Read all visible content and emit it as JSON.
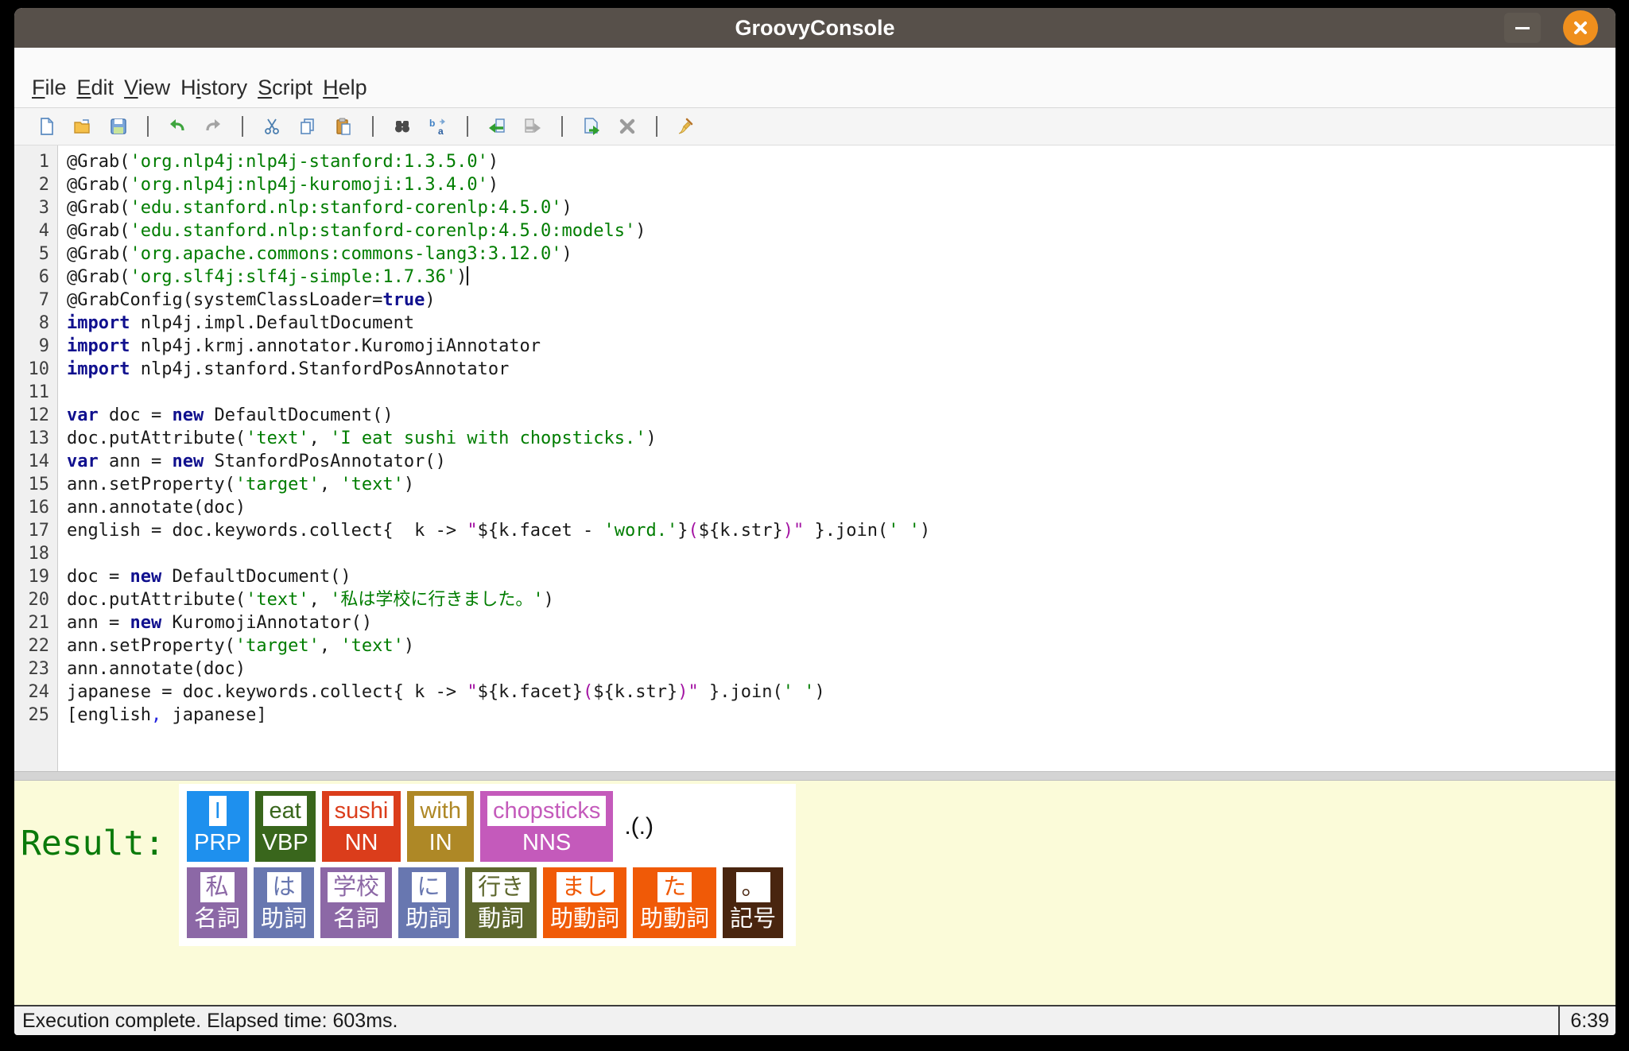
{
  "window": {
    "title": "GroovyConsole"
  },
  "menu": {
    "items": [
      {
        "label": "File",
        "underline": 0
      },
      {
        "label": "Edit",
        "underline": 0
      },
      {
        "label": "View",
        "underline": 0
      },
      {
        "label": "History",
        "underline": 1
      },
      {
        "label": "Script",
        "underline": 0
      },
      {
        "label": "Help",
        "underline": 0
      }
    ]
  },
  "toolbar": {
    "groups": [
      [
        "new-file",
        "open-file",
        "save-file"
      ],
      [
        "undo",
        "redo"
      ],
      [
        "cut",
        "copy",
        "paste"
      ],
      [
        "find",
        "find-replace"
      ],
      [
        "history-previous",
        "history-next"
      ],
      [
        "execute-script",
        "interrupt-script"
      ],
      [
        "clear-output"
      ]
    ]
  },
  "editor": {
    "lines": [
      {
        "no": "1",
        "segs": [
          [
            "p",
            "@Grab("
          ],
          [
            "s",
            "'org.nlp4j:nlp4j-stanford:1.3.5.0'"
          ],
          [
            "p",
            ")"
          ]
        ]
      },
      {
        "no": "2",
        "segs": [
          [
            "p",
            "@Grab("
          ],
          [
            "s",
            "'org.nlp4j:nlp4j-kuromoji:1.3.4.0'"
          ],
          [
            "p",
            ")"
          ]
        ]
      },
      {
        "no": "3",
        "segs": [
          [
            "p",
            "@Grab("
          ],
          [
            "s",
            "'edu.stanford.nlp:stanford-corenlp:4.5.0'"
          ],
          [
            "p",
            ")"
          ]
        ]
      },
      {
        "no": "4",
        "segs": [
          [
            "p",
            "@Grab("
          ],
          [
            "s",
            "'edu.stanford.nlp:stanford-corenlp:4.5.0:models'"
          ],
          [
            "p",
            ")"
          ]
        ]
      },
      {
        "no": "5",
        "segs": [
          [
            "p",
            "@Grab("
          ],
          [
            "s",
            "'org.apache.commons:commons-lang3:3.12.0'"
          ],
          [
            "p",
            ")"
          ]
        ]
      },
      {
        "no": "6",
        "segs": [
          [
            "p",
            "@Grab("
          ],
          [
            "s",
            "'org.slf4j:slf4j-simple:1.7.36'"
          ],
          [
            "p",
            ")"
          ]
        ],
        "caret": true
      },
      {
        "no": "7",
        "segs": [
          [
            "p",
            "@GrabConfig(systemClassLoader="
          ],
          [
            "k",
            "true"
          ],
          [
            "p",
            ")"
          ]
        ]
      },
      {
        "no": "8",
        "segs": [
          [
            "k",
            "import"
          ],
          [
            "p",
            " nlp4j.impl.DefaultDocument"
          ]
        ]
      },
      {
        "no": "9",
        "segs": [
          [
            "k",
            "import"
          ],
          [
            "p",
            " nlp4j.krmj.annotator.KuromojiAnnotator"
          ]
        ]
      },
      {
        "no": "10",
        "segs": [
          [
            "k",
            "import"
          ],
          [
            "p",
            " nlp4j.stanford.StanfordPosAnnotator"
          ]
        ]
      },
      {
        "no": "11",
        "segs": []
      },
      {
        "no": "12",
        "segs": [
          [
            "k",
            "var"
          ],
          [
            "p",
            " doc = "
          ],
          [
            "k",
            "new"
          ],
          [
            "p",
            " DefaultDocument()"
          ]
        ]
      },
      {
        "no": "13",
        "segs": [
          [
            "p",
            "doc.putAttribute("
          ],
          [
            "s",
            "'text'"
          ],
          [
            "p",
            ", "
          ],
          [
            "s",
            "'I eat sushi with chopsticks.'"
          ],
          [
            "p",
            ")"
          ]
        ]
      },
      {
        "no": "14",
        "segs": [
          [
            "k",
            "var"
          ],
          [
            "p",
            " ann = "
          ],
          [
            "k",
            "new"
          ],
          [
            "p",
            " StanfordPosAnnotator()"
          ]
        ]
      },
      {
        "no": "15",
        "segs": [
          [
            "p",
            "ann.setProperty("
          ],
          [
            "s",
            "'target'"
          ],
          [
            "p",
            ", "
          ],
          [
            "s",
            "'text'"
          ],
          [
            "p",
            ")"
          ]
        ]
      },
      {
        "no": "16",
        "segs": [
          [
            "p",
            "ann.annotate(doc)"
          ]
        ]
      },
      {
        "no": "17",
        "segs": [
          [
            "p",
            "english = doc.keywords.collect{  k -> "
          ],
          [
            "g",
            "\""
          ],
          [
            "p",
            "${k.facet - "
          ],
          [
            "s",
            "'word.'"
          ],
          [
            "p",
            "}"
          ],
          [
            "g",
            "("
          ],
          [
            "p",
            "${k.str}"
          ],
          [
            "g",
            ")\""
          ],
          [
            "p",
            " }.join("
          ],
          [
            "s",
            "' '"
          ],
          [
            "p",
            ")"
          ]
        ]
      },
      {
        "no": "18",
        "segs": []
      },
      {
        "no": "19",
        "segs": [
          [
            "p",
            "doc = "
          ],
          [
            "k",
            "new"
          ],
          [
            "p",
            " DefaultDocument()"
          ]
        ]
      },
      {
        "no": "20",
        "segs": [
          [
            "p",
            "doc.putAttribute("
          ],
          [
            "s",
            "'text'"
          ],
          [
            "p",
            ", "
          ],
          [
            "s",
            "'私は学校に行きました。'"
          ],
          [
            "p",
            ")"
          ]
        ]
      },
      {
        "no": "21",
        "segs": [
          [
            "p",
            "ann = "
          ],
          [
            "k",
            "new"
          ],
          [
            "p",
            " KuromojiAnnotator()"
          ]
        ]
      },
      {
        "no": "22",
        "segs": [
          [
            "p",
            "ann.setProperty("
          ],
          [
            "s",
            "'target'"
          ],
          [
            "p",
            ", "
          ],
          [
            "s",
            "'text'"
          ],
          [
            "p",
            ")"
          ]
        ]
      },
      {
        "no": "23",
        "segs": [
          [
            "p",
            "ann.annotate(doc)"
          ]
        ]
      },
      {
        "no": "24",
        "segs": [
          [
            "p",
            "japanese = doc.keywords.collect{ k -> "
          ],
          [
            "g",
            "\""
          ],
          [
            "p",
            "${k.facet}"
          ],
          [
            "g",
            "("
          ],
          [
            "p",
            "${k.str}"
          ],
          [
            "g",
            ")\""
          ],
          [
            "p",
            " }.join("
          ],
          [
            "s",
            "' '"
          ],
          [
            "p",
            ")"
          ]
        ]
      },
      {
        "no": "25",
        "segs": [
          [
            "p",
            "[english"
          ],
          [
            "o",
            ","
          ],
          [
            "p",
            " japanese]"
          ]
        ]
      }
    ]
  },
  "result": {
    "label": "Result:",
    "english": {
      "tokens": [
        {
          "word": "I",
          "tag": "PRP",
          "color": "#1E90EE"
        },
        {
          "word": "eat",
          "tag": "VBP",
          "color": "#39661C"
        },
        {
          "word": "sushi",
          "tag": "NN",
          "color": "#DB3D1B"
        },
        {
          "word": "with",
          "tag": "IN",
          "color": "#AE8826"
        },
        {
          "word": "chopsticks",
          "tag": "NNS",
          "color": "#C45ABB"
        }
      ],
      "suffix": ".(.)"
    },
    "japanese": {
      "tokens": [
        {
          "word": "私",
          "tag": "名詞",
          "color": "#8C68A6"
        },
        {
          "word": "は",
          "tag": "助詞",
          "color": "#6877B0"
        },
        {
          "word": "学校",
          "tag": "名詞",
          "color": "#8C68A6"
        },
        {
          "word": "に",
          "tag": "助詞",
          "color": "#6877B0"
        },
        {
          "word": "行き",
          "tag": "動詞",
          "color": "#5D672D"
        },
        {
          "word": "まし",
          "tag": "助動詞",
          "color": "#F05A07"
        },
        {
          "word": "た",
          "tag": "助動詞",
          "color": "#F05A07"
        },
        {
          "word": "。",
          "tag": "記号",
          "color": "#49250F"
        }
      ]
    }
  },
  "statusbar": {
    "message": "Execution complete. Elapsed time: 603ms.",
    "position": "6:39"
  },
  "colors": {
    "titlebar_bg": "#57504A",
    "close_button": "#EF8F1D",
    "result_bg": "#FBFBD9",
    "result_label": "#0A7A0A",
    "syntax_string": "#007D00",
    "syntax_gstring": "#A313A3",
    "syntax_keyword": "#10108E",
    "syntax_operator": "#2222DD"
  }
}
